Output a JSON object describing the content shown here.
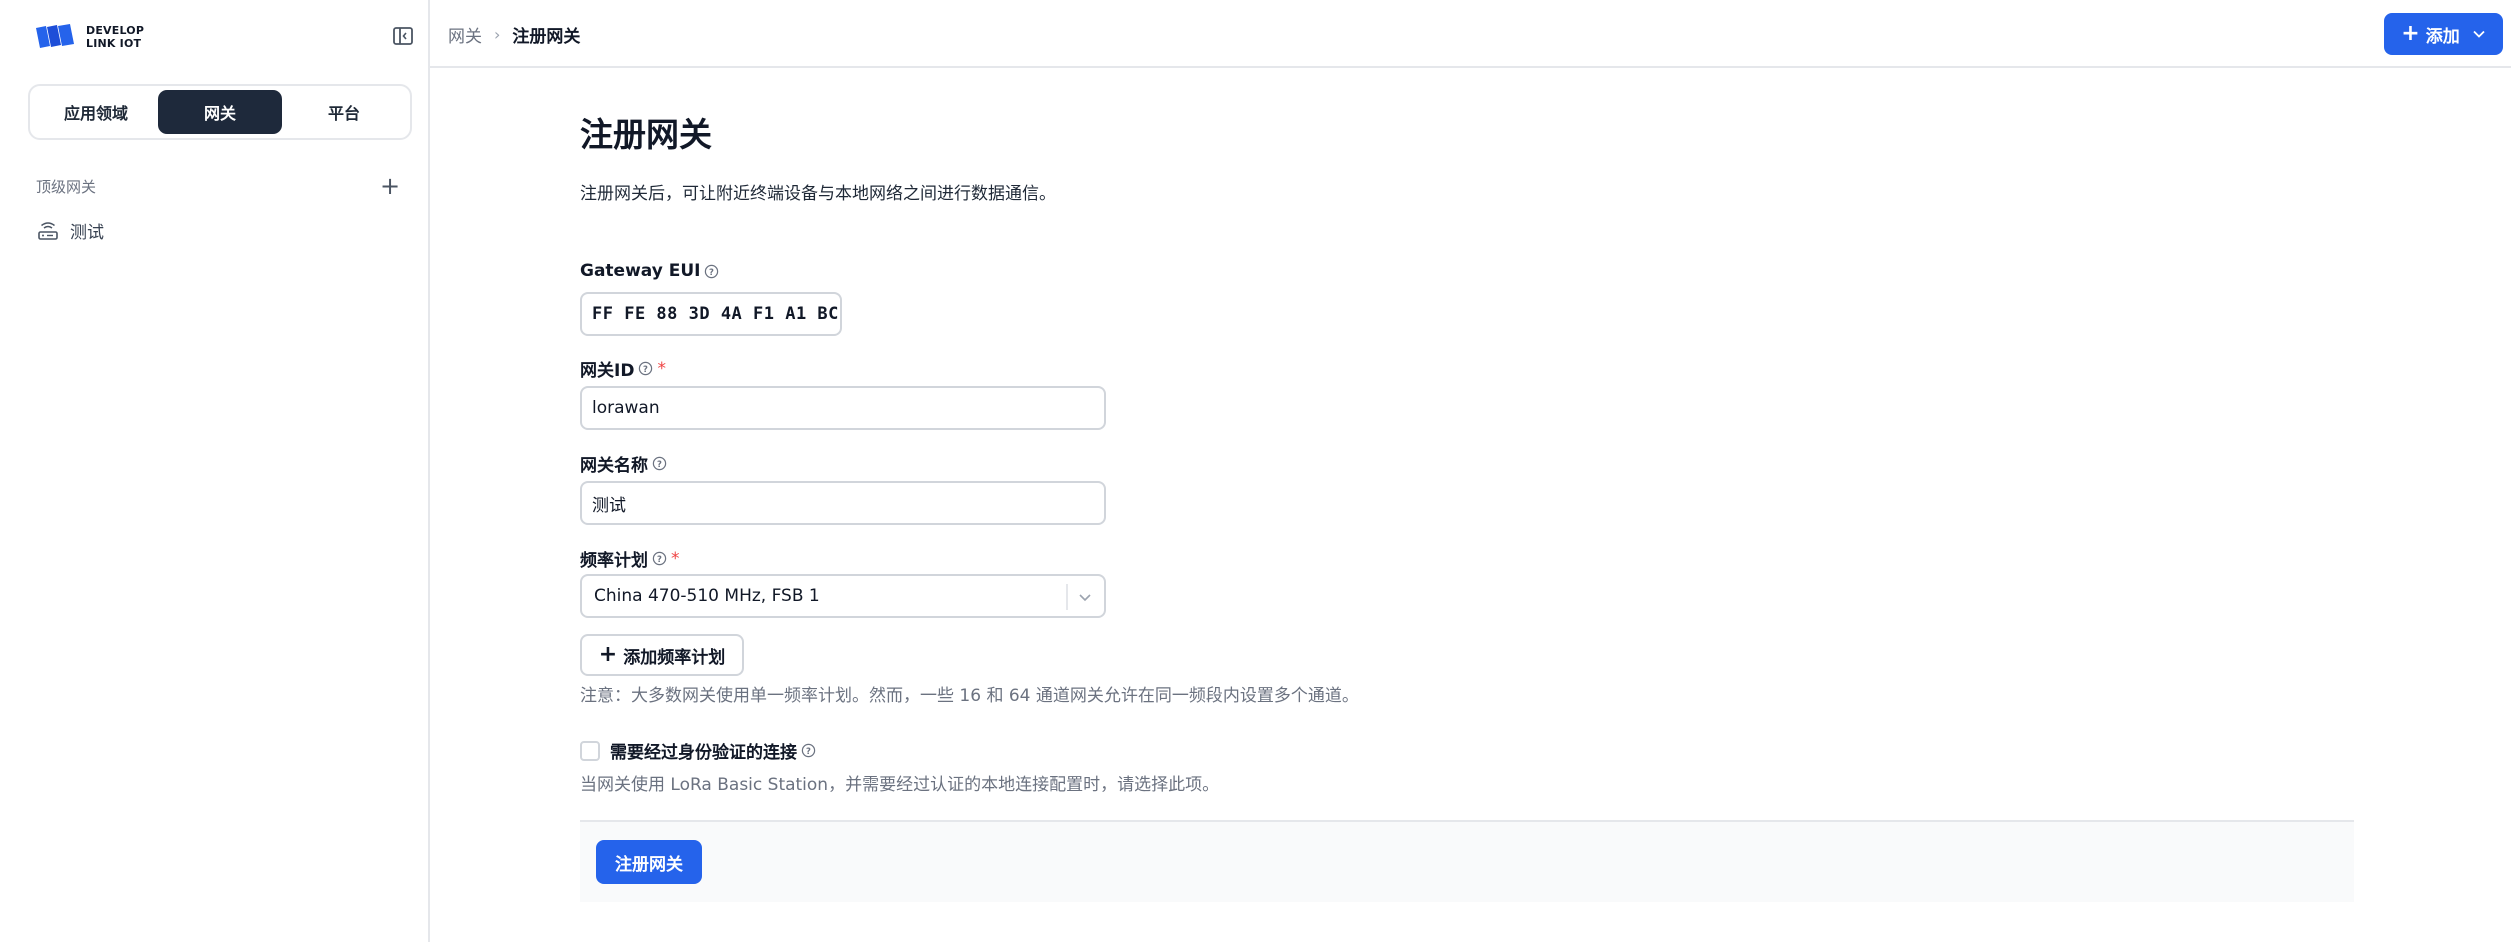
{
  "logo": {
    "line1": "DEVELOP",
    "line2": "LINK IOT"
  },
  "segments": [
    {
      "label": "应用领域",
      "active": false
    },
    {
      "label": "网关",
      "active": true
    },
    {
      "label": "平台",
      "active": false
    }
  ],
  "sidebar": {
    "section_title": "顶级网关",
    "items": [
      {
        "label": "测试",
        "icon": "router-icon"
      }
    ]
  },
  "breadcrumb": {
    "parent": "网关",
    "separator": "›",
    "current": "注册网关"
  },
  "header": {
    "add_label": "添加"
  },
  "form": {
    "title": "注册网关",
    "description": "注册网关后，可让附近终端设备与本地网络之间进行数据通信。",
    "eui": {
      "label": "Gateway EUI",
      "value": "FF FE 88 3D 4A F1 A1 BC"
    },
    "gateway_id": {
      "label": "网关ID",
      "required": "*",
      "value": "lorawan"
    },
    "gateway_name": {
      "label": "网关名称",
      "value": "测试"
    },
    "freq_plan": {
      "label": "频率计划",
      "required": "*",
      "value": "China 470-510 MHz, FSB 1"
    },
    "add_plan_label": "添加频率计划",
    "note": "注意：大多数网关使用单一频率计划。然而，一些 16 和 64 通道网关允许在同一频段内设置多个通道。",
    "auth": {
      "label": "需要经过身份验证的连接",
      "checked": false,
      "help": "当网关使用 LoRa Basic Station，并需要经过认证的本地连接配置时，请选择此项。"
    },
    "submit_label": "注册网关"
  },
  "colors": {
    "primary": "#2563eb",
    "segment_active": "#1e293b",
    "required": "#ef4444"
  }
}
